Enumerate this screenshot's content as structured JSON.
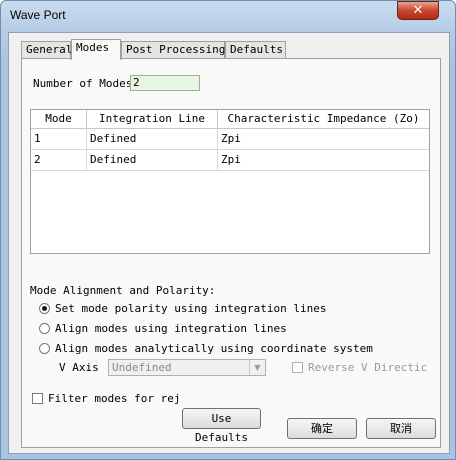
{
  "window": {
    "title": "Wave Port",
    "close_glyph": "✕"
  },
  "tabs": [
    {
      "label": "General"
    },
    {
      "label": "Modes"
    },
    {
      "label": "Post Processing"
    },
    {
      "label": "Defaults"
    }
  ],
  "modes": {
    "number_label": "Number of Modes",
    "number_value": "2",
    "columns": [
      "Mode",
      "Integration Line",
      "Characteristic Impedance (Zo)"
    ],
    "rows": [
      [
        "1",
        "Defined",
        "Zpi"
      ],
      [
        "2",
        "Defined",
        "Zpi"
      ]
    ],
    "alignment_heading": "Mode Alignment and Polarity:",
    "options": [
      {
        "label": "Set mode polarity using integration lines",
        "selected": true
      },
      {
        "label": "Align modes using integration lines",
        "selected": false
      },
      {
        "label": "Align modes analytically using coordinate system",
        "selected": false
      }
    ],
    "v_axis_label": "V Axis",
    "v_axis_value": "Undefined",
    "reverse_label": "Reverse V Directic",
    "filter_label": "Filter modes for rej",
    "use_defaults": "Use Defaults"
  },
  "footer": {
    "ok": "确定",
    "cancel": "取消"
  }
}
